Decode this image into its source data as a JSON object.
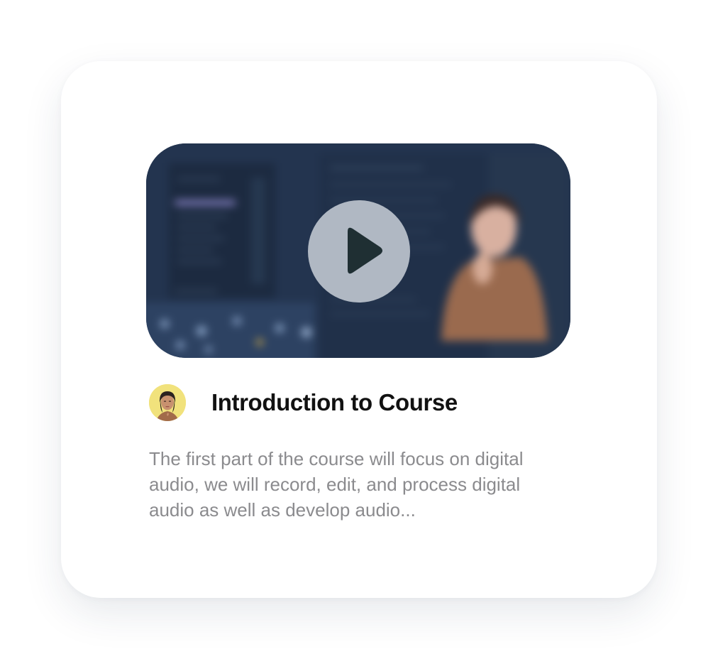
{
  "lesson": {
    "title": "Introduction to Course",
    "description": "The first part of the course will focus on digital audio, we will record, edit, and process digital audio as well as develop audio..."
  },
  "video": {
    "play_icon": "play-icon",
    "thumbnail_background_color": "#23344f",
    "play_button_color": "#c4cbd4",
    "play_glyph_color": "#1f2f33"
  },
  "author": {
    "avatar_background_color": "#f1e27c"
  }
}
